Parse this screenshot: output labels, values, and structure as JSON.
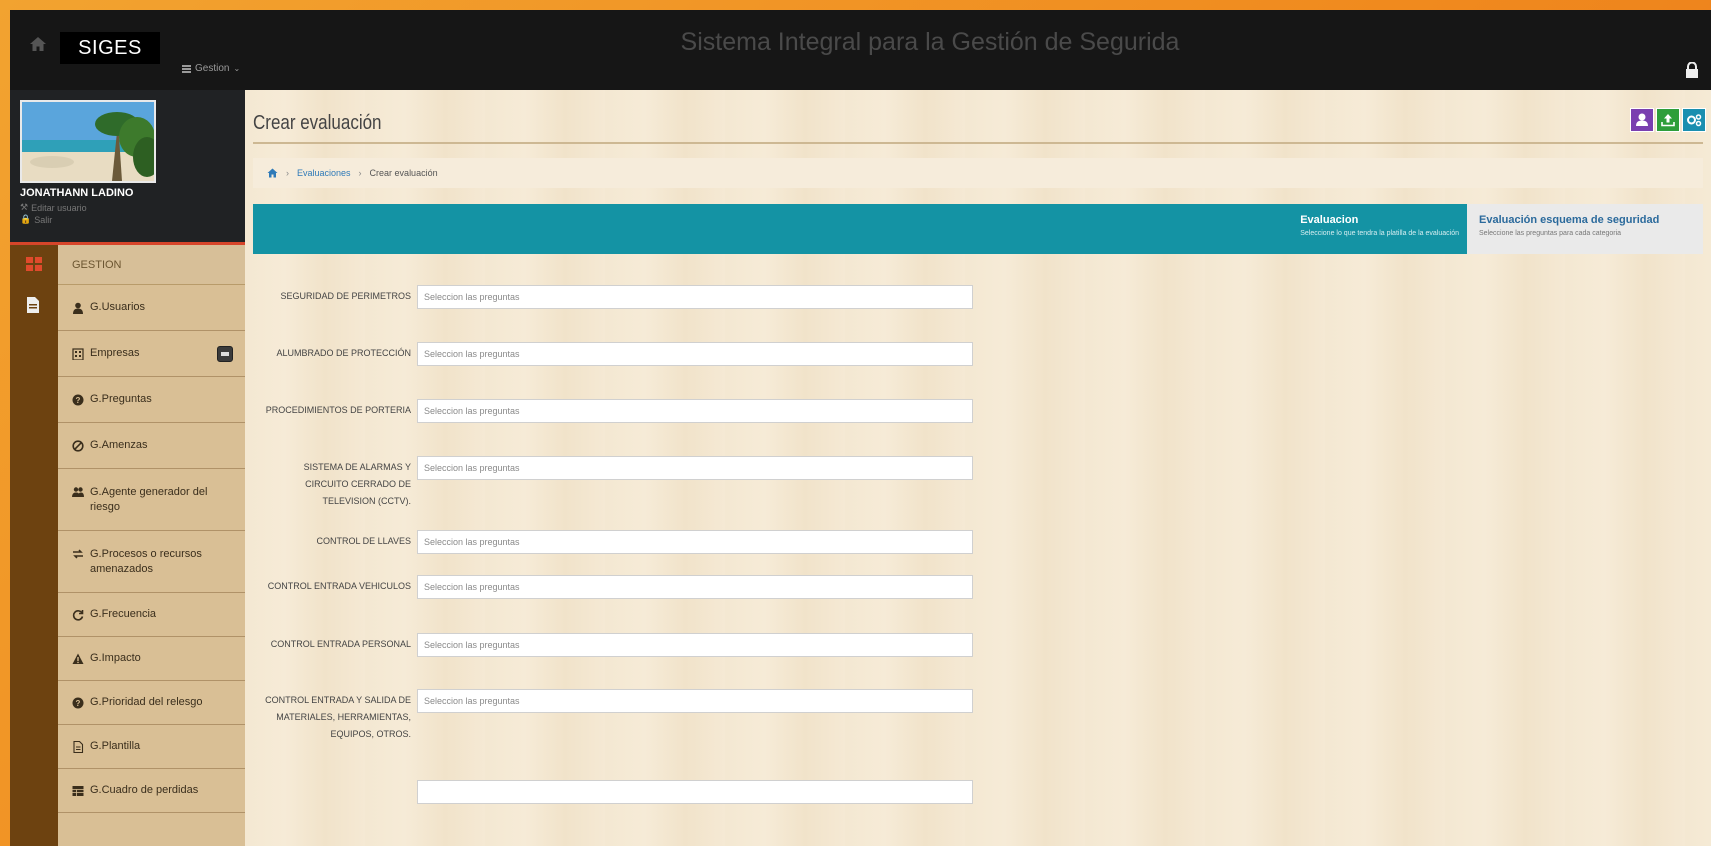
{
  "header": {
    "brand": "SIGES",
    "app_title": "Sistema Integral para la Gestión de Segurida",
    "menu_label": "Gestion"
  },
  "user": {
    "name": "JONATHANN LADINO",
    "edit_label": "Editar usuario",
    "logout_label": "Salir"
  },
  "sidebar": {
    "section_title": "GESTION",
    "items": [
      {
        "label": "G.Usuarios",
        "icon": "user-icon"
      },
      {
        "label": "Empresas",
        "icon": "building-icon"
      },
      {
        "label": "G.Preguntas",
        "icon": "question-icon"
      },
      {
        "label": "G.Amenzas",
        "icon": "ban-icon"
      },
      {
        "label": "G.Agente generador del riesgo",
        "icon": "group-icon"
      },
      {
        "label": "G.Procesos o recursos amenazados",
        "icon": "exchange-icon"
      },
      {
        "label": "G.Frecuencia",
        "icon": "refresh-icon"
      },
      {
        "label": "G.Impacto",
        "icon": "warning-icon"
      },
      {
        "label": "G.Prioridad del relesgo",
        "icon": "question-icon"
      },
      {
        "label": "G.Plantilla",
        "icon": "file-icon"
      },
      {
        "label": "G.Cuadro de perdidas",
        "icon": "table-icon"
      }
    ]
  },
  "page": {
    "title": "Crear evaluación",
    "breadcrumb": {
      "link": "Evaluaciones",
      "current": "Crear evaluación"
    }
  },
  "steps": [
    {
      "title": "Evaluacion",
      "subtitle": "Seleccione lo que tendra la platilla de la evaluación"
    },
    {
      "title": "Evaluación esquema de seguridad",
      "subtitle": "Seleccione las preguntas para cada categoria"
    }
  ],
  "form": {
    "placeholder": "Seleccion las preguntas",
    "fields": [
      {
        "label": "SEGURIDAD DE PERIMETROS"
      },
      {
        "label": "ALUMBRADO DE PROTECCIÓN"
      },
      {
        "label": "PROCEDIMIENTOS DE PORTERIA"
      },
      {
        "label": "SISTEMA DE ALARMAS Y CIRCUITO CERRADO DE TELEVISION (CCTV)."
      },
      {
        "label": "CONTROL DE LLAVES"
      },
      {
        "label": "CONTROL ENTRADA VEHICULOS"
      },
      {
        "label": "CONTROL ENTRADA PERSONAL"
      },
      {
        "label": "CONTROL ENTRADA Y SALIDA DE MATERIALES, HERRAMIENTAS, EQUIPOS, OTROS."
      }
    ]
  },
  "colors": {
    "stepbar": "#1493a4",
    "btn_purple": "#7a3fb0",
    "btn_green": "#2e9e3a",
    "btn_teal": "#1a8fb0",
    "accent_red": "#d6452a"
  }
}
